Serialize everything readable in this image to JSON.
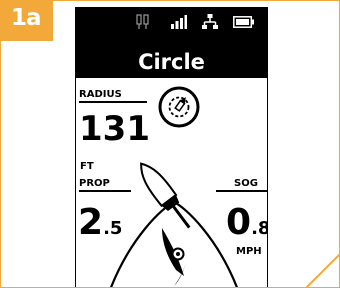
{
  "badge": {
    "label": "1a"
  },
  "header": {
    "mode_title": "Circle",
    "status_icons": [
      "gps-icon",
      "signal-icon",
      "network-icon",
      "battery-icon"
    ]
  },
  "radius": {
    "label": "RADIUS",
    "value": "131",
    "unit": "FT"
  },
  "prop": {
    "label": "PROP",
    "value_int": "2",
    "value_dec": ".5"
  },
  "sog": {
    "label": "SOG",
    "value_int": "0",
    "value_dec": ".8",
    "unit": "MPH"
  },
  "colors": {
    "accent": "#f3a83a",
    "screen_bg": "#ffffff",
    "header_bg": "#000000",
    "text": "#000000"
  }
}
